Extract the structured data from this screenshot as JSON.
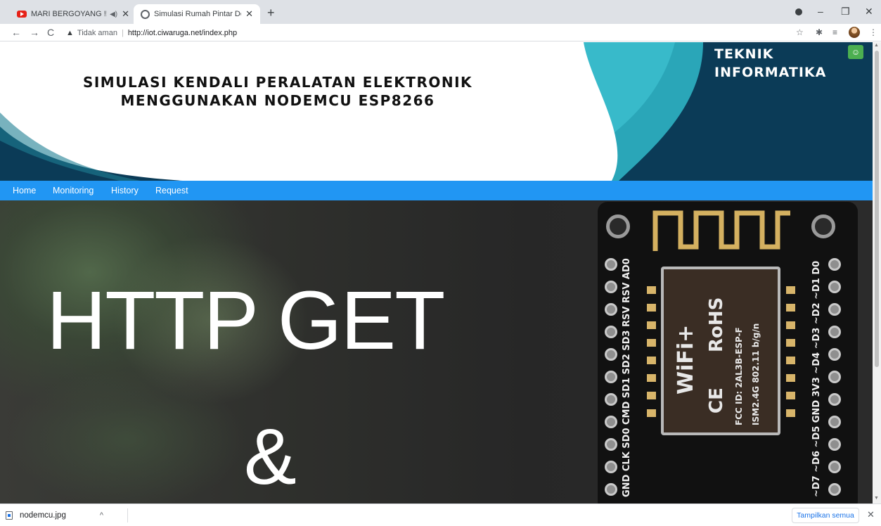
{
  "browser": {
    "tabs": [
      {
        "title": "MARI BERGOYANG !!! KOMP",
        "icon": "youtube-icon",
        "audio_icon": "◀)",
        "close": "✕"
      },
      {
        "title": "Simulasi Rumah Pintar Dengan N",
        "icon": "globe-icon",
        "close": "✕"
      }
    ],
    "new_tab": "+",
    "window_controls": {
      "minimize": "–",
      "restore": "❐",
      "close": "✕"
    },
    "nav": {
      "back": "←",
      "forward": "→",
      "reload": "C"
    },
    "omnibox": {
      "warning_icon": "▲",
      "security_text": "Tidak aman",
      "separator": "|",
      "url": "http://iot.ciwaruga.net/index.php"
    },
    "toolbar_icons": {
      "star": "☆",
      "extensions": "✱",
      "reading_list": "≡",
      "menu": "⋮"
    }
  },
  "site": {
    "title_line1": "SIMULASI KENDALI PERALATAN ELEKTRONIK",
    "title_line2": "MENGGUNAKAN NODEMCU ESP8266",
    "brand_line1": "TEKNIK",
    "brand_line2": "INFORMATIKA",
    "accessibility_icon": "☺",
    "colors": {
      "header_dark": "#0b3b57",
      "header_teal": "#2aa6b8",
      "navbar": "#2196f3"
    },
    "nav": [
      "Home",
      "Monitoring",
      "History",
      "Request"
    ],
    "hero": {
      "line1": "HTTP GET",
      "line2": "&",
      "module": {
        "wifi_logo": "WiFi+",
        "rohs": "RoHS",
        "ce": "CE",
        "fcc": "FCC ID: 2AL3B-ESP-F",
        "ism": "ISM2.4G  802.11 b/g/n"
      },
      "pins_left": "GND CLK SD0 CMD SD1 SD2 SD3 RSV RSV AD0",
      "pins_right": "~D7 ~D6 ~D5 GND 3V3 ~D4 ~D3 ~D2 ~D1 D0"
    }
  },
  "downloads": {
    "file": "nodemcu.jpg",
    "chevron": "^",
    "show_all": "Tampilkan semua",
    "close": "✕"
  }
}
